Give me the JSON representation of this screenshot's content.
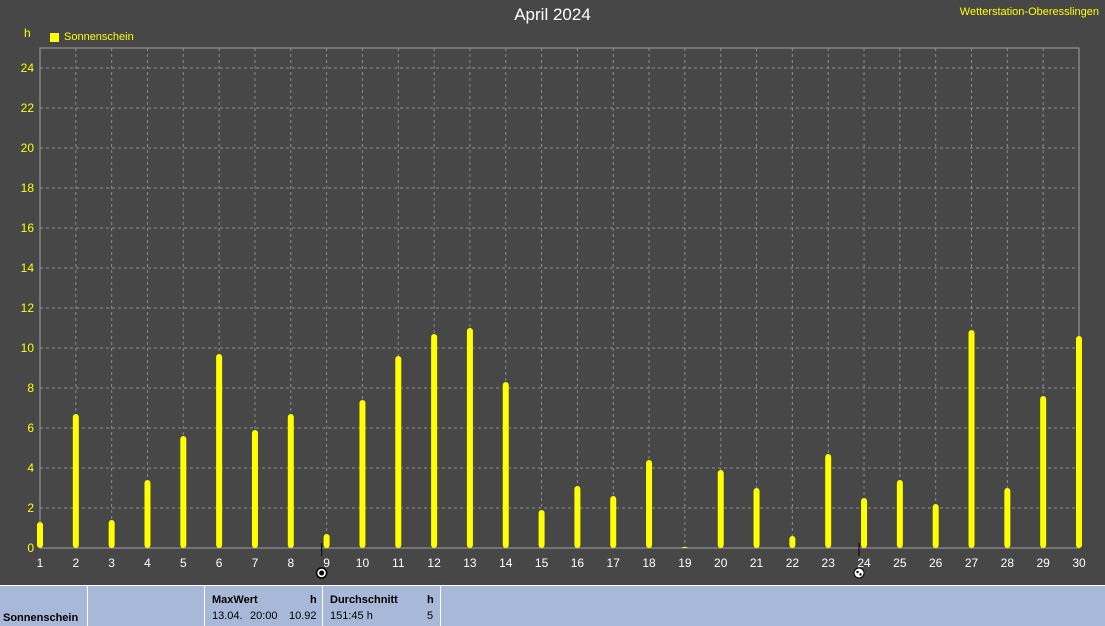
{
  "header": {
    "title": "April 2024",
    "station": "Wetterstation-Oberesslingen",
    "unit": "h",
    "legend_label": "Sonnenschein"
  },
  "colors": {
    "background": "#474747",
    "bar": "#ffff00",
    "grid": "#8c8c8c",
    "axis_text": "#ffff00",
    "footer_bg": "#a8b8d8"
  },
  "chart_data": {
    "type": "bar",
    "title": "April 2024",
    "ylabel": "h",
    "ylim": [
      0,
      25
    ],
    "y_ticks": [
      0,
      2,
      4,
      6,
      8,
      10,
      12,
      14,
      16,
      18,
      20,
      22,
      24
    ],
    "grid": true,
    "legend_placement": "top-left",
    "categories": [
      "1",
      "2",
      "3",
      "4",
      "5",
      "6",
      "7",
      "8",
      "9",
      "10",
      "11",
      "12",
      "13",
      "14",
      "15",
      "16",
      "17",
      "18",
      "19",
      "20",
      "21",
      "22",
      "23",
      "24",
      "25",
      "26",
      "27",
      "28",
      "29",
      "30"
    ],
    "series": [
      {
        "name": "Sonnenschein",
        "color": "#ffff00",
        "values": [
          1.3,
          6.7,
          1.4,
          3.4,
          5.6,
          9.7,
          5.9,
          6.7,
          0.7,
          7.4,
          9.6,
          10.7,
          11.0,
          8.3,
          1.9,
          3.1,
          2.6,
          4.4,
          0.05,
          3.9,
          3.0,
          0.6,
          4.7,
          2.5,
          3.4,
          2.2,
          10.9,
          3.0,
          7.6,
          10.6
        ]
      }
    ],
    "moon_markers": [
      {
        "day": "9",
        "icon": "new-moon-icon"
      },
      {
        "day": "24",
        "icon": "full-moon-icon"
      }
    ]
  },
  "footer": {
    "row_label": "Sonnenschein",
    "max": {
      "header": "MaxWert",
      "unit": "h",
      "date": "13.04.",
      "time": "20:00",
      "value": "10.92"
    },
    "avg": {
      "header": "Durchschnitt",
      "unit": "h",
      "total": "151:45 h",
      "value": "5"
    }
  }
}
